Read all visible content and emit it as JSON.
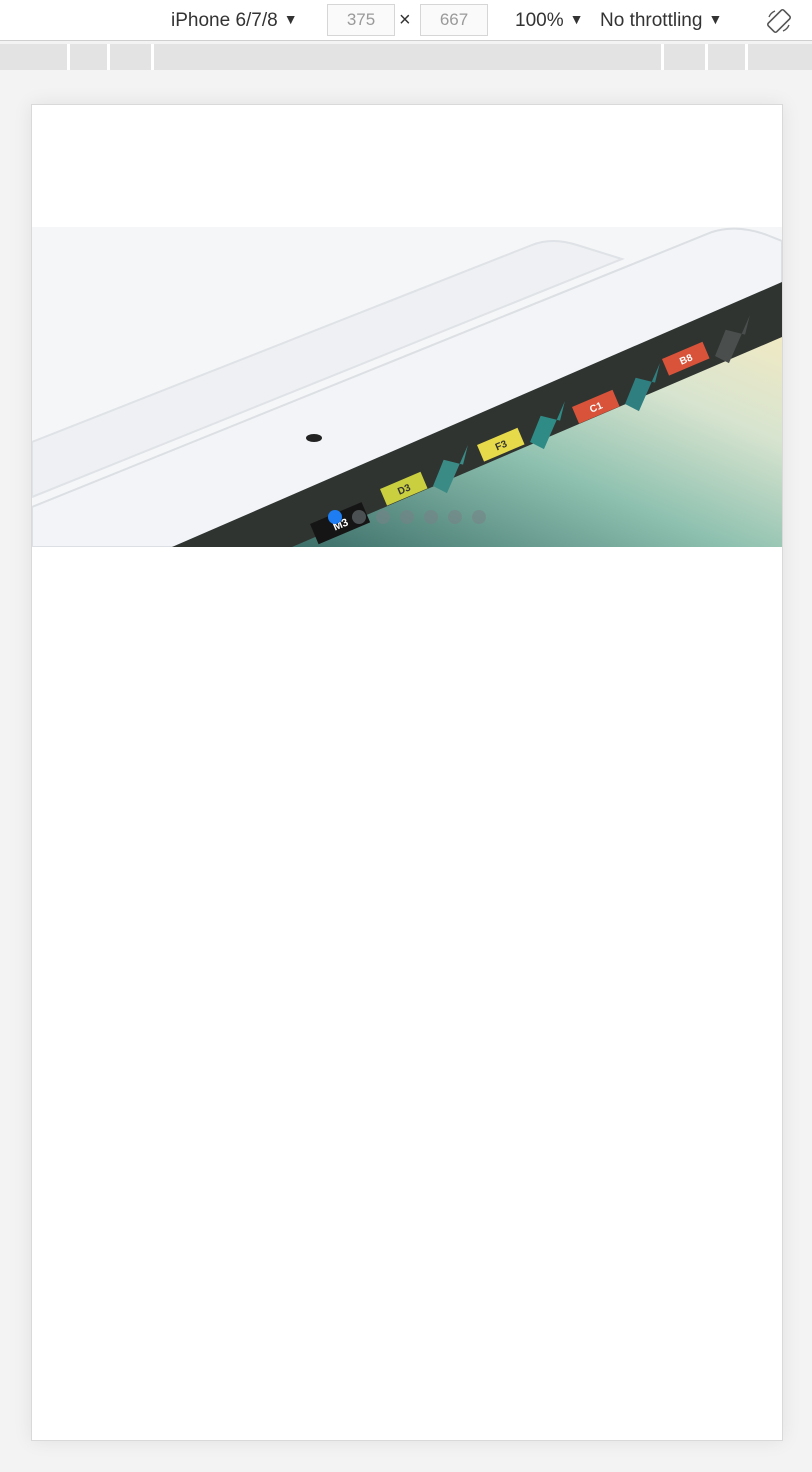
{
  "toolbar": {
    "device": "iPhone 6/7/8",
    "width_value": "375",
    "height_value": "667",
    "times_symbol": "×",
    "zoom": "100%",
    "throttling": "No throttling",
    "caret": "▼"
  },
  "carousel": {
    "slide_count": 7,
    "active_index": 0,
    "tile_labels": [
      "M3",
      "D3",
      "F3",
      "C1",
      "B8"
    ],
    "colors": {
      "active_dot": "#1e7df2",
      "tile_red": "#d9533a",
      "tile_yellow": "#e6d94a",
      "tile_lime": "#c9cf3e",
      "dark_bar": "#2f3431"
    }
  }
}
